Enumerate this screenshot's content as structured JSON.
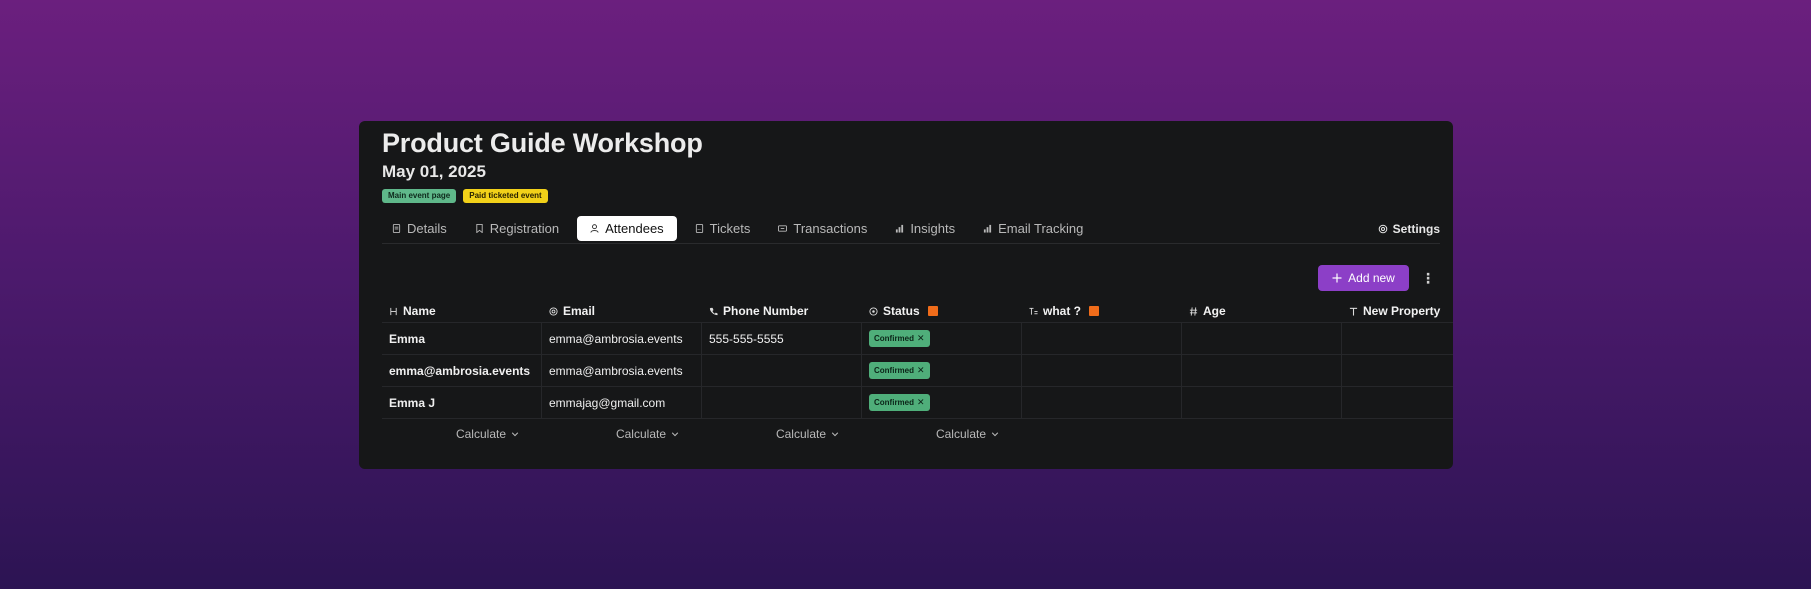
{
  "event": {
    "title": "Product Guide Workshop",
    "date": "May 01, 2025",
    "badges": [
      {
        "label": "Main event page",
        "color": "#5fb88a"
      },
      {
        "label": "Paid ticketed event",
        "color": "#f2d119"
      }
    ]
  },
  "tabs": [
    {
      "label": "Details",
      "icon": "document-icon"
    },
    {
      "label": "Registration",
      "icon": "bookmark-icon"
    },
    {
      "label": "Attendees",
      "icon": "person-icon",
      "active": true
    },
    {
      "label": "Tickets",
      "icon": "ticket-icon"
    },
    {
      "label": "Transactions",
      "icon": "card-icon"
    },
    {
      "label": "Insights",
      "icon": "bar-chart-icon"
    },
    {
      "label": "Email Tracking",
      "icon": "bar-chart-icon"
    }
  ],
  "settings_label": "Settings",
  "toolbar": {
    "add_label": "Add new",
    "more_label": "⋮"
  },
  "table": {
    "columns": [
      {
        "label": "Name",
        "icon": "heading-icon"
      },
      {
        "label": "Email",
        "icon": "at-icon"
      },
      {
        "label": "Phone Number",
        "icon": "phone-icon"
      },
      {
        "label": "Status",
        "icon": "circle-check-icon"
      },
      {
        "label": "what ?",
        "icon": "text-format-icon"
      },
      {
        "label": "Age",
        "icon": "hash-icon"
      },
      {
        "label": "New Property",
        "icon": "text-icon"
      }
    ],
    "rows": [
      {
        "name": "Emma",
        "email": "emma@ambrosia.events",
        "phone": "555-555-5555",
        "status": "Confirmed"
      },
      {
        "name": "emma@ambrosia.events",
        "email": "emma@ambrosia.events",
        "phone": "",
        "status": "Confirmed"
      },
      {
        "name": "Emma J",
        "email": "emmajag@gmail.com",
        "phone": "",
        "status": "Confirmed"
      }
    ],
    "calculate_label": "Calculate",
    "status_color": "#4fae7a",
    "accent_warning": "#f06c1a"
  }
}
